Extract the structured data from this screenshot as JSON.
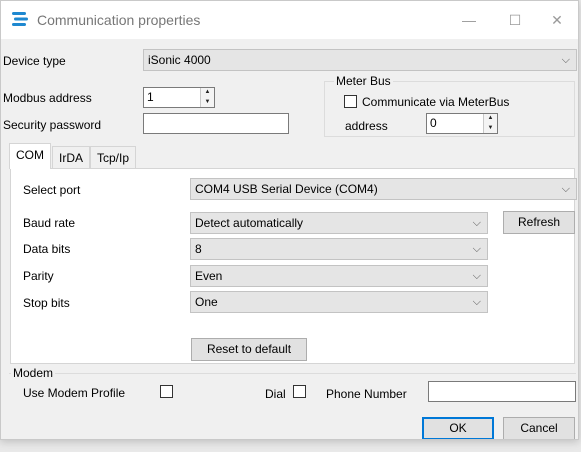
{
  "window": {
    "title": "Communication properties",
    "minimize_glyph": "—",
    "maximize_glyph": "☐",
    "close_glyph": "✕",
    "icon": "app-logo-icon",
    "accent_color": "#1e88d0"
  },
  "device": {
    "label": "Device type",
    "value": "iSonic 4000"
  },
  "modbus": {
    "label": "Modbus address",
    "value": "1"
  },
  "security": {
    "label": "Security password",
    "value": ""
  },
  "meterbus": {
    "legend": "Meter Bus",
    "checkbox_label": "Communicate via MeterBus",
    "address_label": "address",
    "address_value": "0"
  },
  "tabs": [
    {
      "label": "COM"
    },
    {
      "label": "IrDA"
    },
    {
      "label": "Tcp/Ip"
    }
  ],
  "com": {
    "select_port_label": "Select port",
    "select_port_value": "COM4   USB Serial Device (COM4)",
    "baud_rate_label": "Baud rate",
    "baud_rate_value": "Detect automatically",
    "refresh_label": "Refresh",
    "data_bits_label": "Data bits",
    "data_bits_value": "8",
    "parity_label": "Parity",
    "parity_value": "Even",
    "stop_bits_label": "Stop bits",
    "stop_bits_value": "One",
    "reset_label": "Reset to default"
  },
  "modem": {
    "legend": "Modem",
    "use_profile_label": "Use Modem Profile",
    "dial_label": "Dial",
    "phone_label": "Phone Number",
    "phone_value": ""
  },
  "footer": {
    "ok_label": "OK",
    "cancel_label": "Cancel"
  },
  "glyphs": {
    "dropdown_arrow": "⌵",
    "spin_up": "▲",
    "spin_down": "▼"
  }
}
